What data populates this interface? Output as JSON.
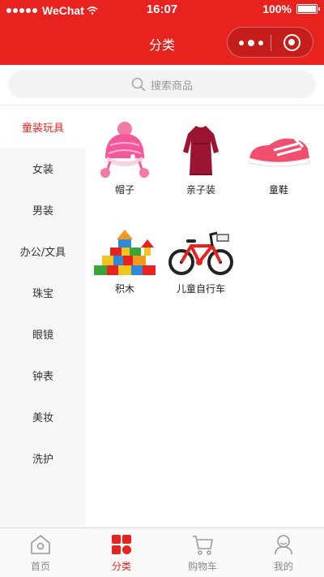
{
  "status": {
    "carrier": "WeChat",
    "time": "16:07",
    "battery": "100%"
  },
  "nav": {
    "title": "分类"
  },
  "search": {
    "placeholder": "搜索商品"
  },
  "sidebar": {
    "items": [
      {
        "label": "童装玩具",
        "active": true
      },
      {
        "label": "女装",
        "active": false
      },
      {
        "label": "男装",
        "active": false
      },
      {
        "label": "办公/文具",
        "active": false
      },
      {
        "label": "珠宝",
        "active": false
      },
      {
        "label": "眼镜",
        "active": false
      },
      {
        "label": "钟表",
        "active": false
      },
      {
        "label": "美妆",
        "active": false
      },
      {
        "label": "洗护",
        "active": false
      }
    ]
  },
  "products": [
    {
      "name": "帽子",
      "icon": "knit-hat-icon"
    },
    {
      "name": "亲子装",
      "icon": "dress-icon"
    },
    {
      "name": "童鞋",
      "icon": "kids-shoe-icon"
    },
    {
      "name": "积木",
      "icon": "building-blocks-icon"
    },
    {
      "name": "儿童自行车",
      "icon": "kids-bike-icon"
    }
  ],
  "tabbar": {
    "tabs": [
      {
        "label": "首页",
        "icon": "home-icon",
        "active": false
      },
      {
        "label": "分类",
        "icon": "category-icon",
        "active": true
      },
      {
        "label": "购物车",
        "icon": "cart-icon",
        "active": false
      },
      {
        "label": "我的",
        "icon": "profile-icon",
        "active": false
      }
    ]
  },
  "colors": {
    "brand": "#e8231f",
    "sidebar_bg": "#f7f7f7",
    "inactive_text": "#888888"
  }
}
